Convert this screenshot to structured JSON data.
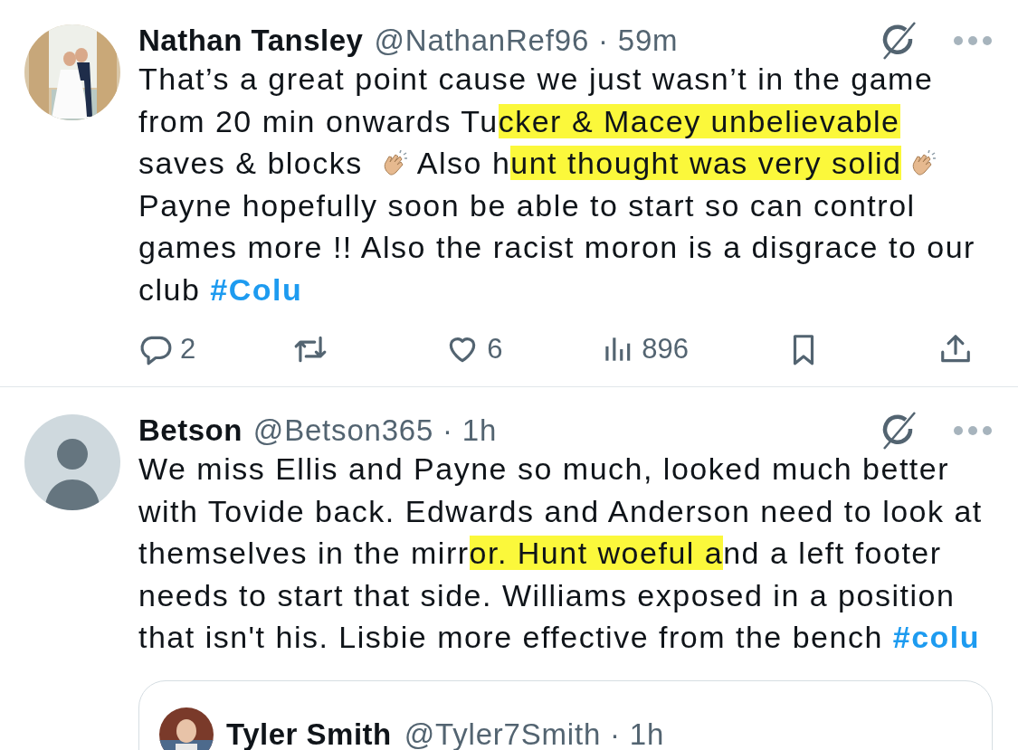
{
  "tweets": [
    {
      "name": "Nathan Tansley",
      "handle_time": "@NathanRef96 · 59m",
      "body": [
        {
          "kind": "text",
          "text": "That’s a great point cause we just wasn’t in the game from 20 min onwards Tu"
        },
        {
          "kind": "highlight",
          "text": "cker & Macey unbelievable"
        },
        {
          "kind": "text",
          "text": " saves & blocks "
        },
        {
          "kind": "clap"
        },
        {
          "kind": "text",
          "text": " Also h"
        },
        {
          "kind": "highlight",
          "text": "unt thought was very solid"
        },
        {
          "kind": "clap"
        },
        {
          "kind": "text",
          "text": " Payne hopefully soon be able to start so can control games more !! Also the racist moron is a disgrace to our club "
        },
        {
          "kind": "hashtag",
          "text": "#Colu"
        }
      ],
      "actions": [
        {
          "kind": "reply",
          "count": "2"
        },
        {
          "kind": "repost"
        },
        {
          "kind": "like",
          "count": "6"
        },
        {
          "kind": "views",
          "count": "896"
        },
        {
          "kind": "bookmark"
        },
        {
          "kind": "share"
        }
      ]
    },
    {
      "avatar": {
        "kind": "default"
      },
      "name": "Betson",
      "handle_time": "@Betson365 · 1h",
      "body": [
        {
          "kind": "text",
          "text": "We miss Ellis and Payne so much, looked much better with Tovide back. Edwards and Anderson need to look at themselves in the mirr"
        },
        {
          "kind": "highlight",
          "text": "or. Hunt woeful a"
        },
        {
          "kind": "text",
          "text": "nd a left footer needs to start that side. Williams exposed in a position that isn't his. Lisbie more effective from the bench "
        },
        {
          "kind": "hashtag",
          "text": "#colu"
        }
      ],
      "quoted": {
        "name": "Tyler Smith",
        "handle_time": "@Tyler7Smith · 1h"
      }
    }
  ]
}
